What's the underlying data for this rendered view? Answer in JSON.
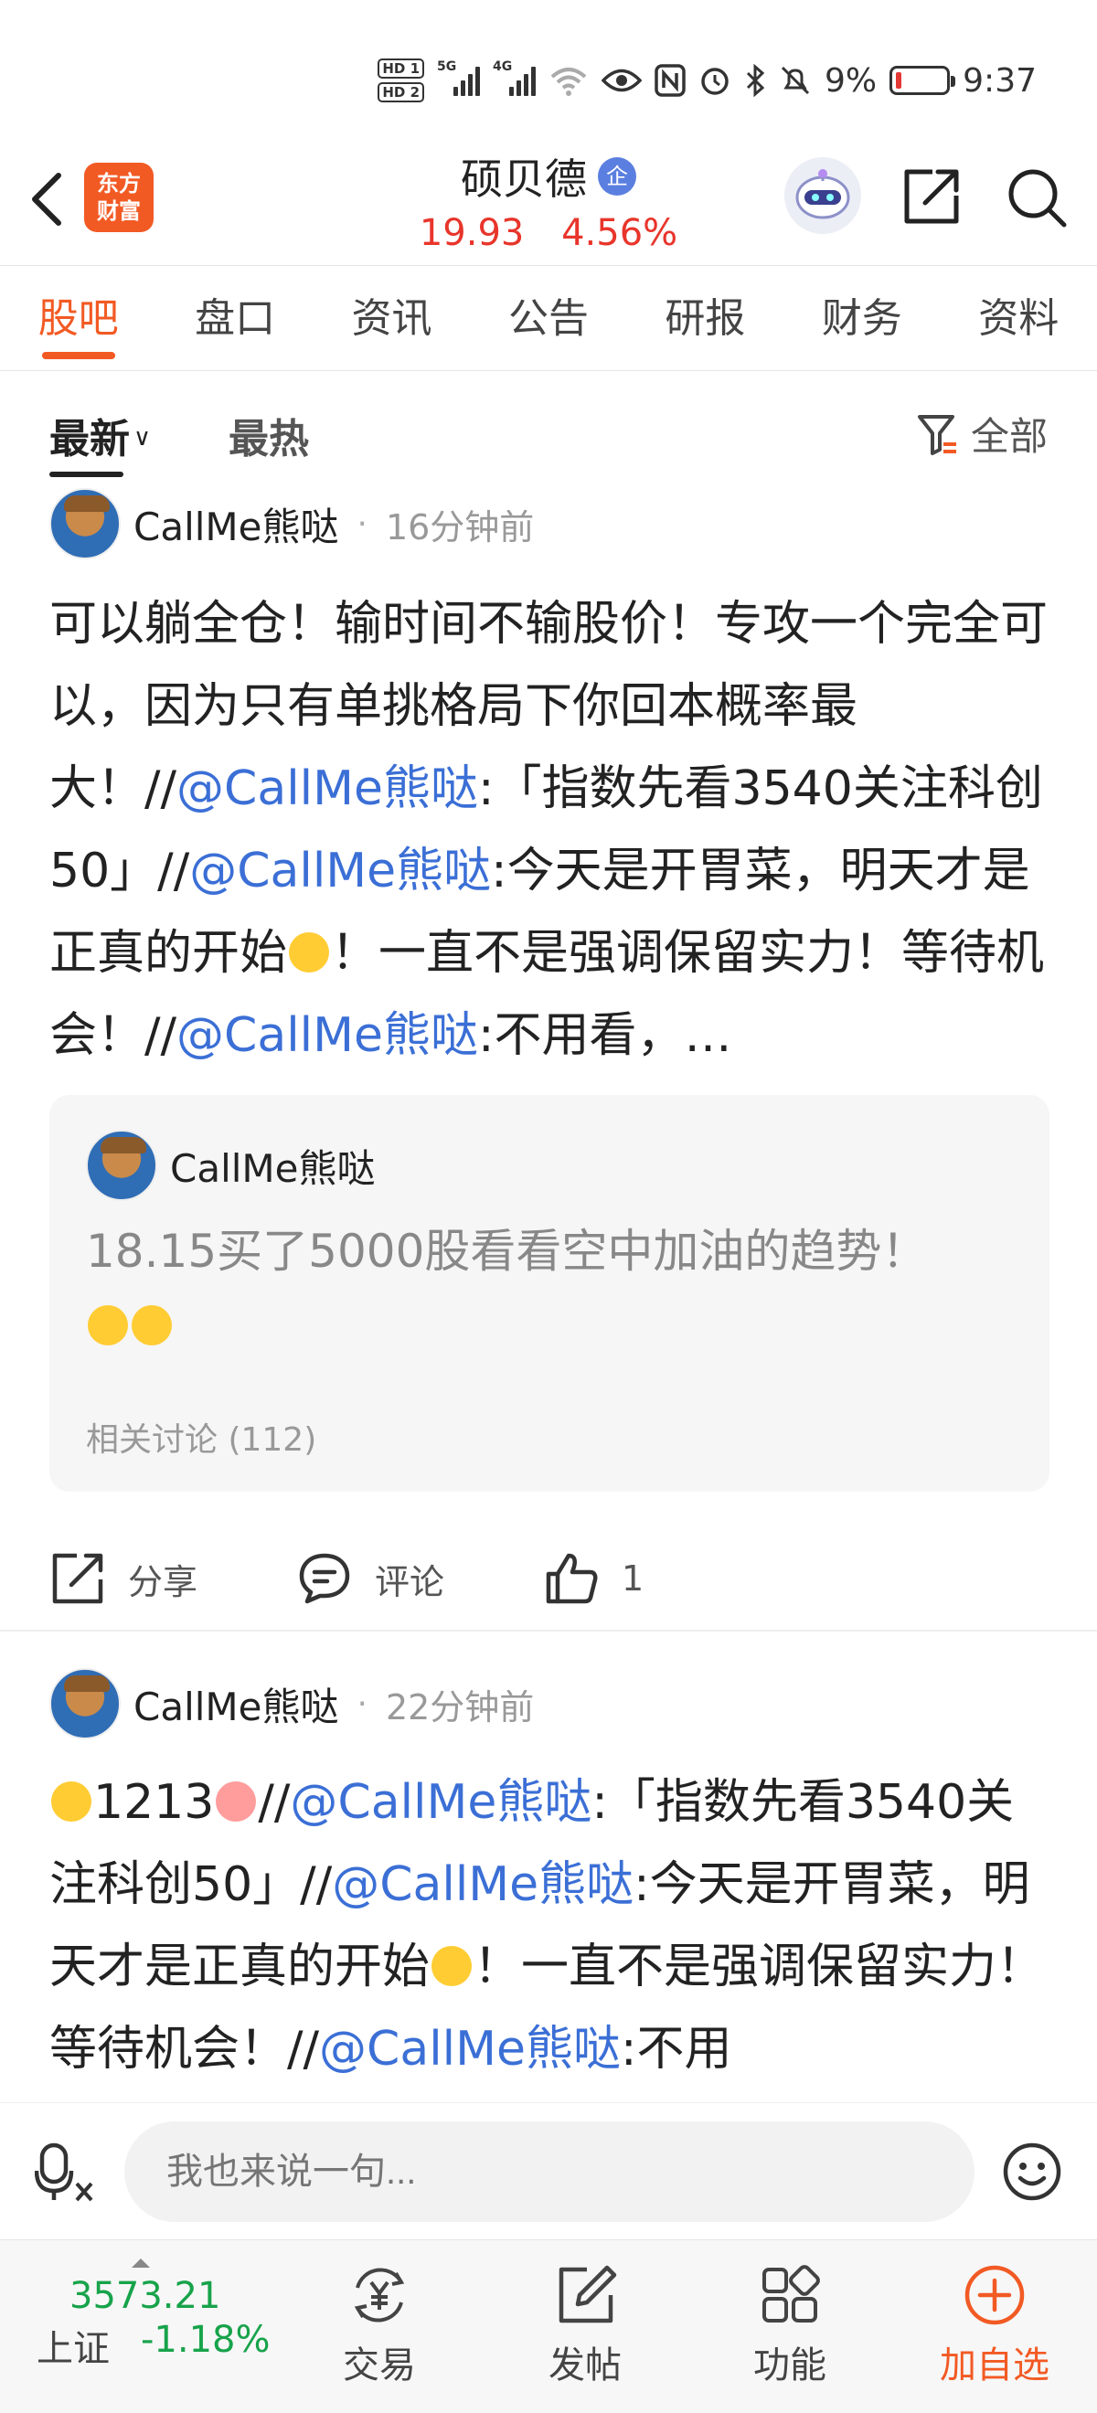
{
  "status_bar": {
    "hd1": "HD 1",
    "hd2": "HD 2",
    "net1": "5G",
    "net2": "4G",
    "battery": "9%",
    "time": "9:37"
  },
  "header": {
    "logo_line1": "东方",
    "logo_line2": "财富",
    "stock_name": "硕贝德",
    "badge": "企",
    "price": "19.93",
    "change_pct": "4.56%"
  },
  "tabs": [
    "股吧",
    "盘口",
    "资讯",
    "公告",
    "研报",
    "财务",
    "资料"
  ],
  "filters": {
    "latest": "最新",
    "hot": "最热",
    "all": "全部"
  },
  "posts": [
    {
      "author": "CallMe熊哒",
      "time": "16分钟前",
      "segments": {
        "s1": "可以躺全仓！输时间不输股价！专攻一个完全可以，因为只有单挑格局下你回本概率最大！//",
        "at1": "@CallMe熊哒",
        "s2": ":「指数先看3540关注科创50」//",
        "at2": "@CallMe熊哒",
        "s3": ":今天是开胃菜，明天才是正真的开始",
        "s4": "！一直不是强调保留实力！等待机会！//",
        "at3": "@CallMe熊哒",
        "s5": ":不用看，…"
      },
      "quote": {
        "author": "CallMe熊哒",
        "text": "18.15买了5000股看看空中加油的趋势！",
        "related": "相关讨论 (112)"
      },
      "actions": {
        "share": "分享",
        "comment": "评论",
        "likes": "1"
      }
    },
    {
      "author": "CallMe熊哒",
      "time": "22分钟前",
      "segments": {
        "s1": "1213",
        "s2": "//",
        "at1": "@CallMe熊哒",
        "s3": ":「指数先看3540关注科创50」//",
        "at2": "@CallMe熊哒",
        "s4": ":今天是开胃菜，明天才是正真的开始",
        "s5": "！一直不是强调保留实力！等待机会！//",
        "at3": "@CallMe熊哒",
        "s6": ":不用"
      }
    }
  ],
  "input": {
    "placeholder": "我也来说一句..."
  },
  "bottom_nav": {
    "index_value": "3573.21",
    "index_name": "上证",
    "index_change": "-1.18%",
    "trade": "交易",
    "post": "发帖",
    "function": "功能",
    "add_watch": "加自选"
  },
  "colors": {
    "accent": "#f25a24",
    "up": "#e8352b",
    "down": "#17a34a",
    "link": "#3b6fd6"
  }
}
